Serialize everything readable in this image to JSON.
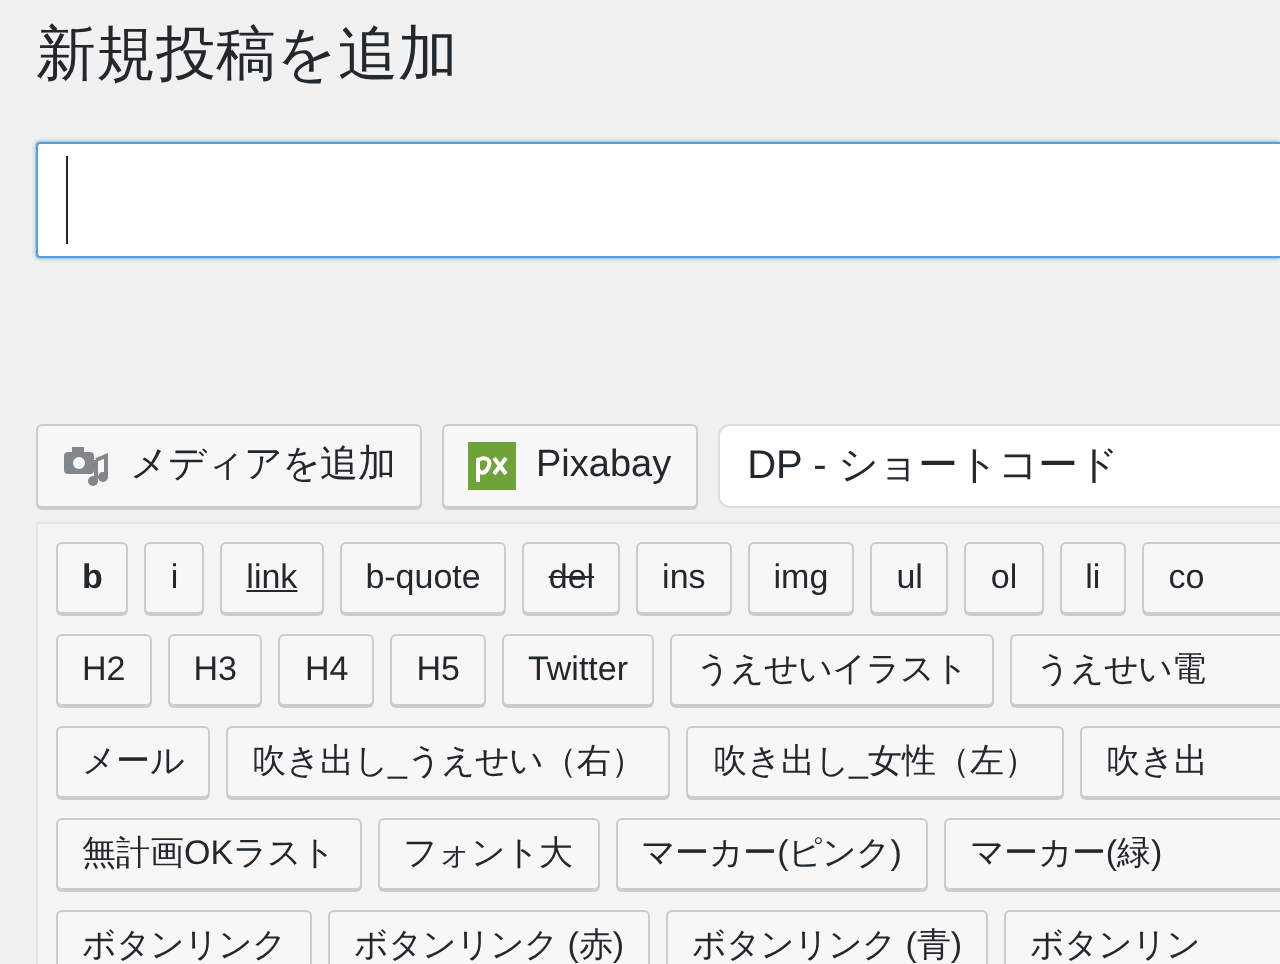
{
  "page_title": "新規投稿を追加",
  "title_field": {
    "focused": true
  },
  "media_buttons": [
    {
      "label": "メディアを追加",
      "kind": "media"
    },
    {
      "label": "Pixabay",
      "kind": "pixabay"
    }
  ],
  "shortcode_select": {
    "value": "DP - ショートコード"
  },
  "quicktags": [
    [
      {
        "label": "b",
        "kind": "bold"
      },
      {
        "label": "i",
        "kind": "plain"
      },
      {
        "label": "link",
        "kind": "underline"
      },
      {
        "label": "b-quote",
        "kind": "plain"
      },
      {
        "label": "del",
        "kind": "strike"
      },
      {
        "label": "ins",
        "kind": "plain"
      },
      {
        "label": "img",
        "kind": "plain"
      },
      {
        "label": "ul",
        "kind": "plain"
      },
      {
        "label": "ol",
        "kind": "plain"
      },
      {
        "label": "li",
        "kind": "plain"
      },
      {
        "label": "co",
        "kind": "plain"
      }
    ],
    [
      {
        "label": "H2",
        "kind": "plain"
      },
      {
        "label": "H3",
        "kind": "plain"
      },
      {
        "label": "H4",
        "kind": "plain"
      },
      {
        "label": "H5",
        "kind": "plain"
      },
      {
        "label": "Twitter",
        "kind": "plain"
      },
      {
        "label": "うえせいイラスト",
        "kind": "plain"
      },
      {
        "label": "うえせい電",
        "kind": "plain"
      }
    ],
    [
      {
        "label": "メール",
        "kind": "plain"
      },
      {
        "label": "吹き出し_うえせい（右）",
        "kind": "plain"
      },
      {
        "label": "吹き出し_女性（左）",
        "kind": "plain"
      },
      {
        "label": "吹き出",
        "kind": "plain"
      }
    ],
    [
      {
        "label": "無計画OKラスト",
        "kind": "plain"
      },
      {
        "label": "フォント大",
        "kind": "plain"
      },
      {
        "label": "マーカー(ピンク)",
        "kind": "plain"
      },
      {
        "label": "マーカー(緑)",
        "kind": "plain"
      }
    ],
    [
      {
        "label": "ボタンリンク",
        "kind": "plain"
      },
      {
        "label": "ボタンリンク (赤)",
        "kind": "plain"
      },
      {
        "label": "ボタンリンク (青)",
        "kind": "plain"
      },
      {
        "label": "ボタンリン",
        "kind": "plain"
      }
    ]
  ]
}
